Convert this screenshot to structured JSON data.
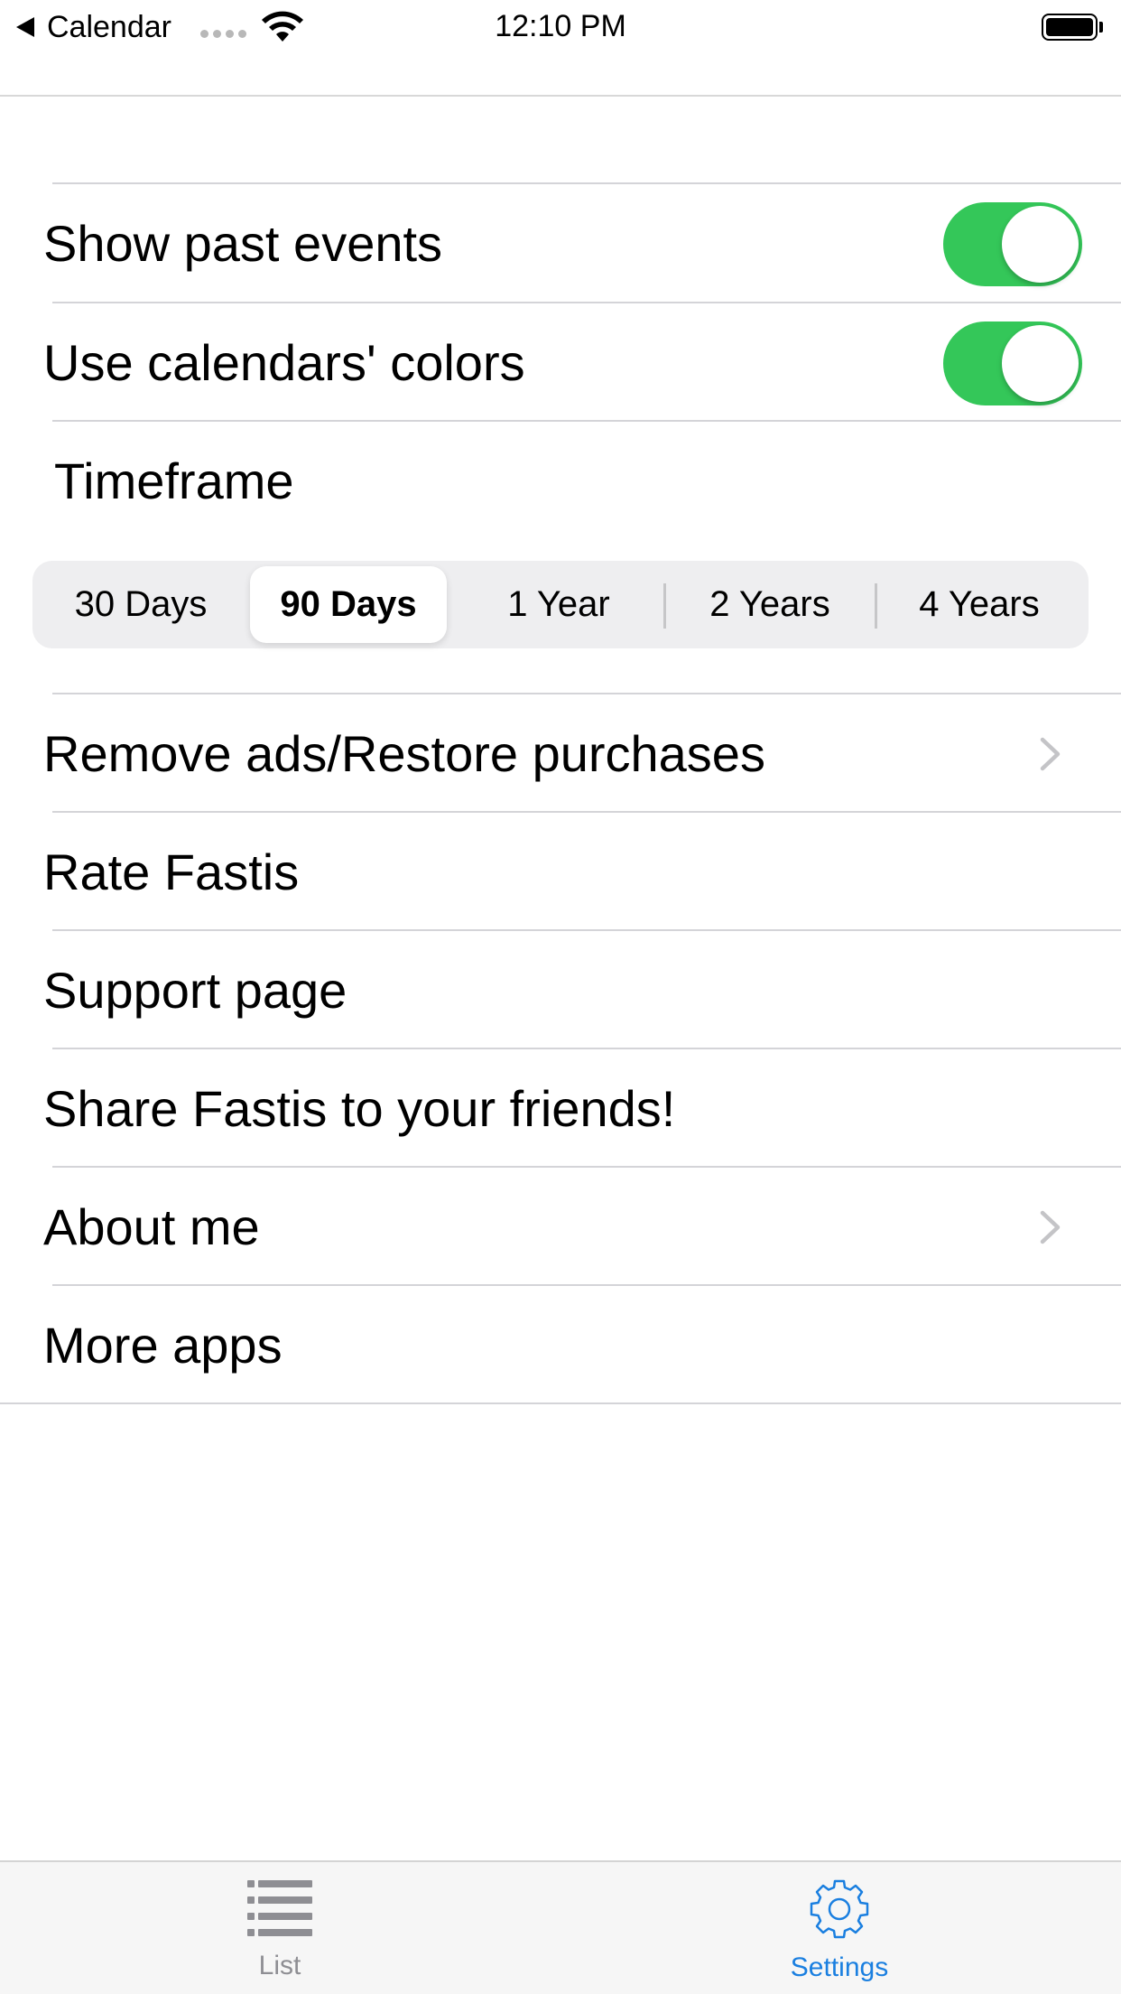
{
  "status_bar": {
    "back_label": "Calendar",
    "time": "12:10 PM"
  },
  "settings": {
    "show_past_events": {
      "label": "Show past events",
      "on": true
    },
    "use_calendar_colors": {
      "label": "Use calendars' colors",
      "on": true
    },
    "timeframe": {
      "title": "Timeframe",
      "options": [
        "30 Days",
        "90 Days",
        "1 Year",
        "2 Years",
        "4 Years"
      ],
      "selected": "90 Days"
    },
    "links": {
      "remove_ads": "Remove ads/Restore purchases",
      "rate": "Rate Fastis",
      "support": "Support page",
      "share": "Share Fastis to your friends!",
      "about": "About me",
      "more_apps": "More apps"
    }
  },
  "tab_bar": {
    "list_label": "List",
    "settings_label": "Settings",
    "active": "Settings"
  },
  "colors": {
    "toggle_on": "#34c759",
    "accent": "#1a7fe0",
    "inactive_tab": "#8e8e93"
  },
  "icons": [
    "back-arrow-icon",
    "wifi-icon",
    "battery-icon",
    "chevron-right-icon",
    "list-icon",
    "gear-icon"
  ]
}
